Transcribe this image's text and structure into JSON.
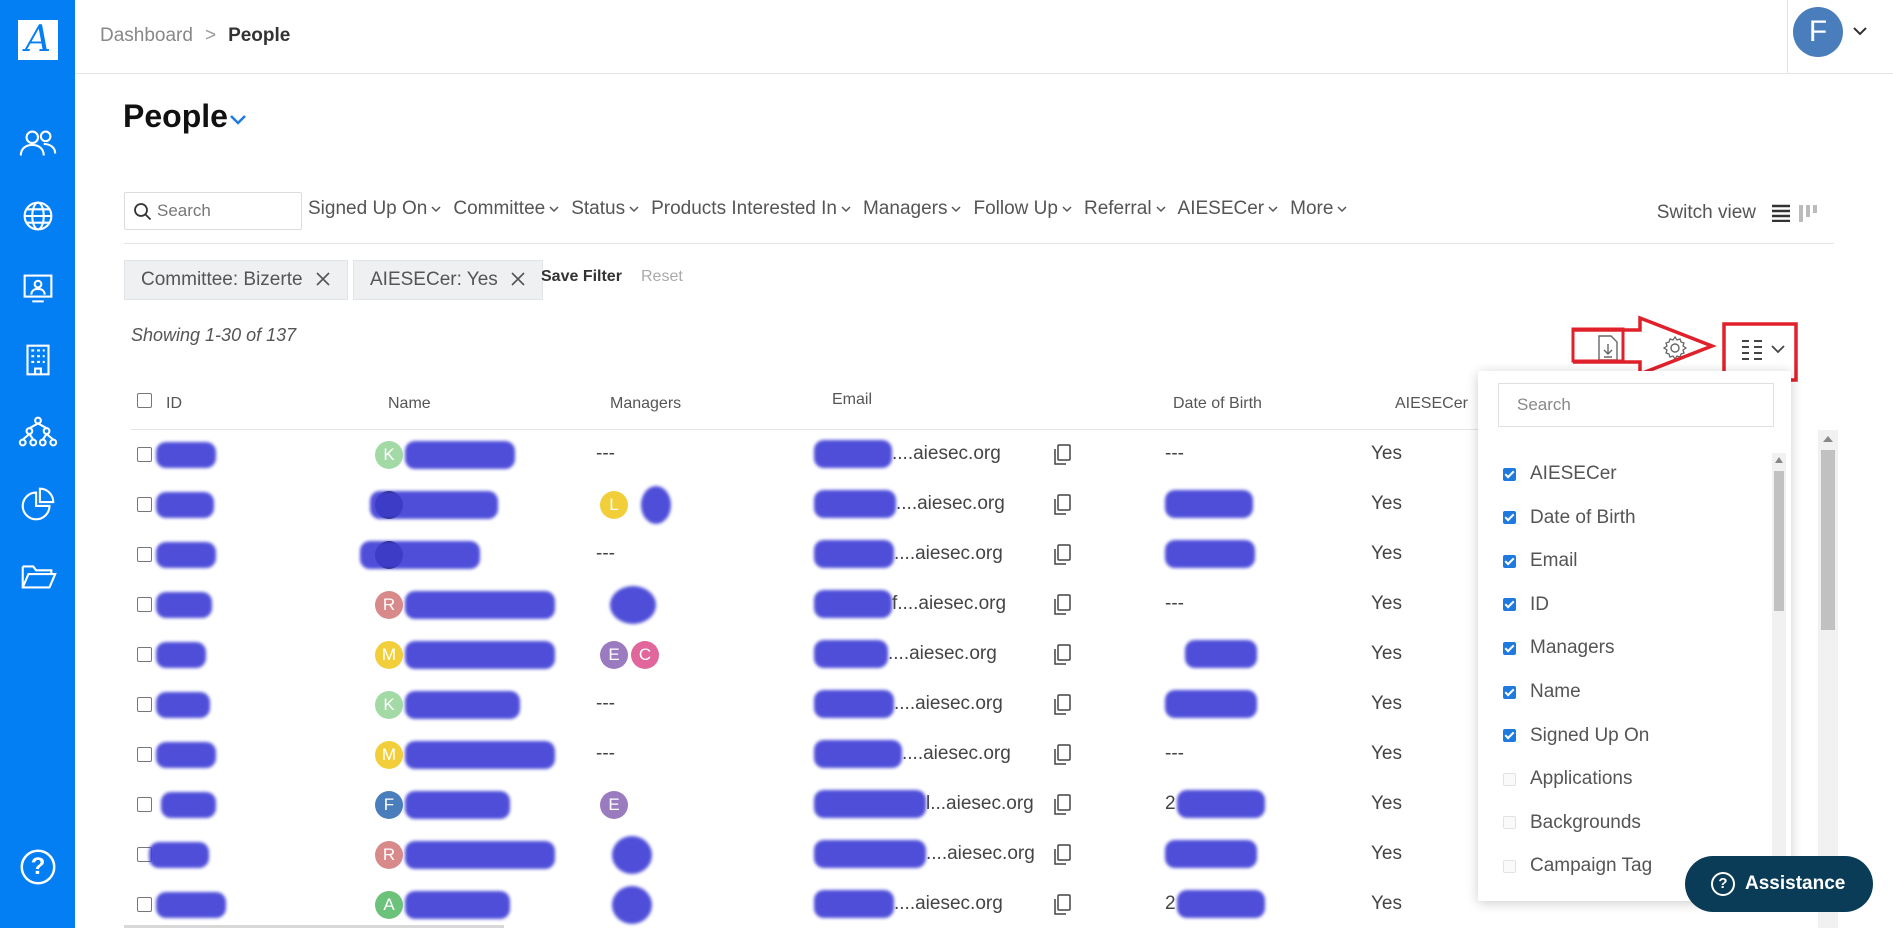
{
  "breadcrumb": {
    "root": "Dashboard",
    "current": "People"
  },
  "user": {
    "initial": "F"
  },
  "page": {
    "title": "People"
  },
  "search": {
    "placeholder": "Search"
  },
  "filters": [
    "Signed Up On",
    "Committee",
    "Status",
    "Products Interested In",
    "Managers",
    "Follow Up",
    "Referral",
    "AIESECer",
    "More"
  ],
  "switch_view": "Switch view",
  "chips": [
    {
      "label": "Committee: Bizerte"
    },
    {
      "label": "AIESECer: Yes"
    }
  ],
  "actions": {
    "save_filter": "Save Filter",
    "reset": "Reset"
  },
  "showing": "Showing  1-30 of 137",
  "table": {
    "columns": {
      "id": "ID",
      "name": "Name",
      "managers": "Managers",
      "email": "Email",
      "dob": "Date of Birth",
      "aiesecer": "AIESECer"
    },
    "rows": [
      {
        "name_initial": "K",
        "name_color": "#a3d9a5",
        "managers": "---",
        "email_suffix": "....aiesec.org",
        "dob": "---",
        "aiesecer": "Yes"
      },
      {
        "name_initial": "",
        "name_color": "",
        "managers": "",
        "manager_initial": "L",
        "manager_color": "#f2cf3a",
        "email_suffix": "....aiesec.org",
        "dob": "",
        "aiesecer": "Yes"
      },
      {
        "name_initial": "",
        "name_color": "",
        "managers": "---",
        "email_suffix": "....aiesec.org",
        "dob": "",
        "aiesecer": "Yes"
      },
      {
        "name_initial": "R",
        "name_color": "#d88a8a",
        "managers": "",
        "email_suffix": "f....aiesec.org",
        "dob": "---",
        "aiesecer": "Yes"
      },
      {
        "name_initial": "M",
        "name_color": "#f2cf3a",
        "managers": "",
        "manager_initials": [
          "E",
          "C"
        ],
        "email_suffix": "....aiesec.org",
        "dob": "",
        "aiesecer": "Yes"
      },
      {
        "name_initial": "K",
        "name_color": "#a3d9a5",
        "managers": "---",
        "email_suffix": "....aiesec.org",
        "dob": "",
        "aiesecer": "Yes"
      },
      {
        "name_initial": "M",
        "name_color": "#f2cf3a",
        "managers": "---",
        "email_suffix": "....aiesec.org",
        "dob": "---",
        "aiesecer": "Yes"
      },
      {
        "name_initial": "F",
        "name_color": "#4a7dbb",
        "managers": "",
        "manager_initial": "E",
        "manager_color": "#9b7bbf",
        "email_suffix": "l...aiesec.org",
        "dob": "2",
        "aiesecer": "Yes"
      },
      {
        "name_initial": "R",
        "name_color": "#d88a8a",
        "managers": "",
        "email_suffix": "....aiesec.org",
        "dob": "",
        "aiesecer": "Yes"
      },
      {
        "name_initial": "A",
        "name_color": "#6cc27a",
        "managers": "",
        "email_suffix": "....aiesec.org",
        "dob": "2",
        "aiesecer": "Yes"
      }
    ]
  },
  "column_panel": {
    "search_placeholder": "Search",
    "items": [
      {
        "label": "AIESECer",
        "checked": true
      },
      {
        "label": "Date of Birth",
        "checked": true
      },
      {
        "label": "Email",
        "checked": true
      },
      {
        "label": "ID",
        "checked": true
      },
      {
        "label": "Managers",
        "checked": true
      },
      {
        "label": "Name",
        "checked": true
      },
      {
        "label": "Signed Up On",
        "checked": true
      },
      {
        "label": "Applications",
        "checked": false
      },
      {
        "label": "Backgrounds",
        "checked": false
      },
      {
        "label": "Campaign Tag",
        "checked": false
      }
    ]
  },
  "assistance": {
    "label": "Assistance",
    "glyph": "?"
  },
  "help": {
    "glyph": "?"
  },
  "colors": {
    "brand": "#037ef3",
    "annotation": "#e0202a",
    "assist_bg": "#0a3b57"
  }
}
